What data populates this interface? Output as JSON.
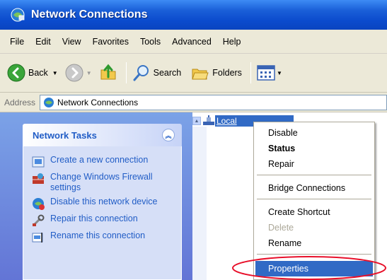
{
  "window": {
    "title": "Network Connections",
    "icon": "network-connections-icon"
  },
  "menubar": {
    "items": [
      "File",
      "Edit",
      "View",
      "Favorites",
      "Tools",
      "Advanced",
      "Help"
    ]
  },
  "toolbar": {
    "back_label": "Back",
    "search_label": "Search",
    "folders_label": "Folders"
  },
  "address": {
    "label": "Address",
    "value": "Network Connections"
  },
  "network_tasks": {
    "header": "Network Tasks",
    "collapse_icon": "chevron-up-icon",
    "tasks": [
      {
        "label": "Create a new connection",
        "icon": "new-connection-icon"
      },
      {
        "label": "Change Windows Firewall settings",
        "icon": "firewall-icon"
      },
      {
        "label": "Disable this network device",
        "icon": "disable-device-icon"
      },
      {
        "label": "Repair this connection",
        "icon": "repair-icon"
      },
      {
        "label": "Rename this connection",
        "icon": "rename-icon"
      }
    ]
  },
  "connection": {
    "label": "Local",
    "selected": true
  },
  "context_menu": {
    "items": [
      {
        "label": "Disable"
      },
      {
        "label": "Status",
        "bold": true
      },
      {
        "label": "Repair"
      },
      {
        "label": "Bridge Connections"
      },
      {
        "label": "Create Shortcut"
      },
      {
        "label": "Delete",
        "disabled": true
      },
      {
        "label": "Rename"
      },
      {
        "label": "Properties",
        "selected": true
      }
    ]
  },
  "annotation": {
    "color": "#e8102a"
  },
  "colors": {
    "title_bar": "#0b4bcd",
    "task_pane": "#6b86dc",
    "task_link": "#215dc6",
    "selection": "#316ac5"
  }
}
